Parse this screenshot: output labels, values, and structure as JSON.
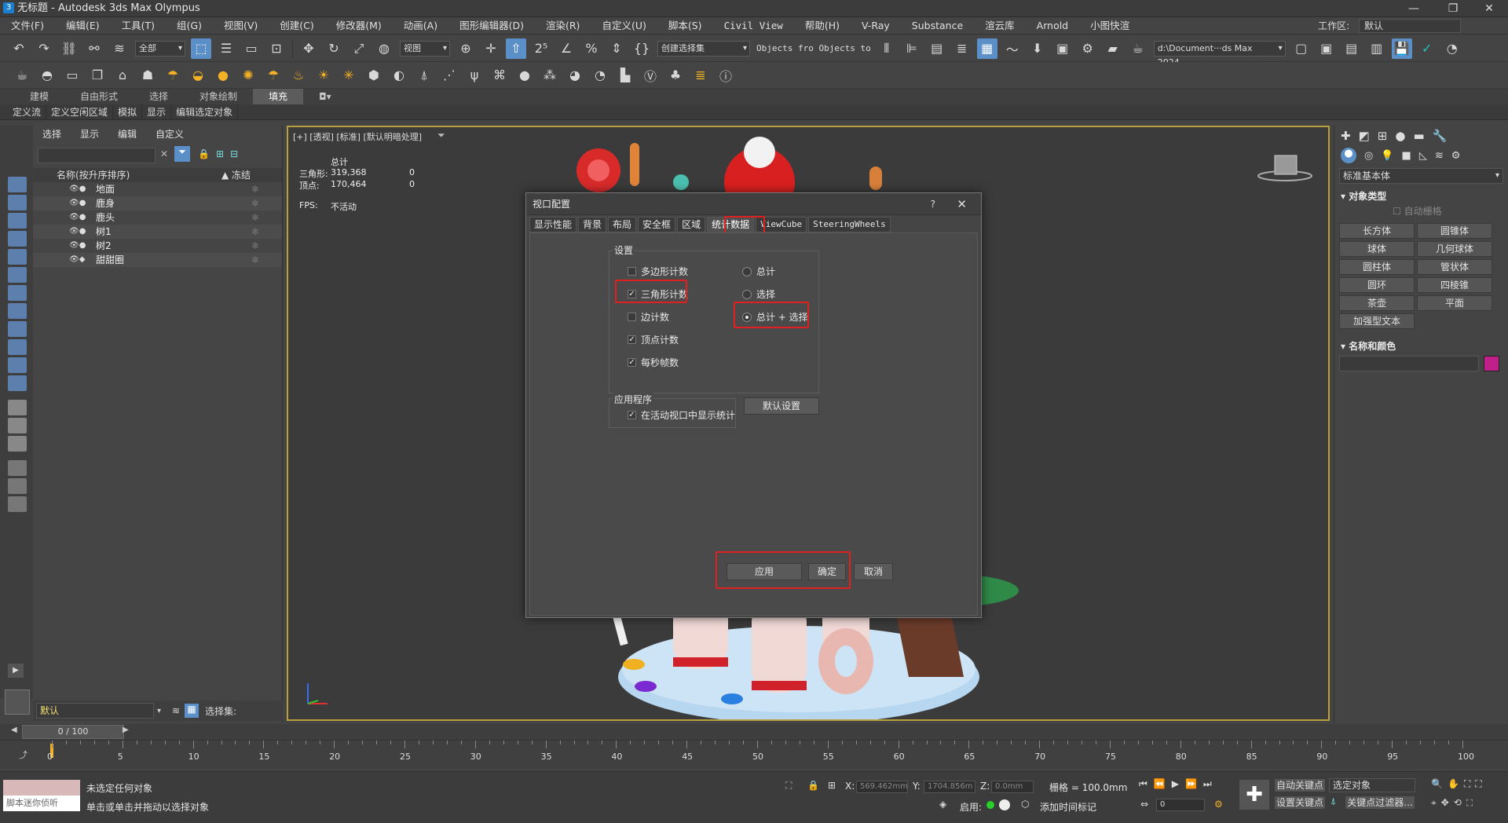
{
  "titlebar": {
    "title": "无标题 - Autodesk 3ds Max Olympus",
    "min": "—",
    "restore": "❐",
    "close": "✕"
  },
  "menu": [
    "文件(F)",
    "编辑(E)",
    "工具(T)",
    "组(G)",
    "视图(V)",
    "创建(C)",
    "修改器(M)",
    "动画(A)",
    "图形编辑器(D)",
    "渲染(R)",
    "自定义(U)",
    "脚本(S)",
    "Civil View",
    "帮助(H)",
    "V-Ray",
    "Substance",
    "渲云库",
    "Arnold",
    "小图快渲"
  ],
  "workspace": {
    "label": "工作区:",
    "value": "默认"
  },
  "toolbar1": {
    "filter_combo": "全部",
    "view_combo": "视图",
    "selset_combo": "创建选择集",
    "objects_text": "Objects fro Objects to",
    "path_combo": "d:\\Document···ds Max 2024"
  },
  "ribbon": {
    "tabs": [
      "建模",
      "自由形式",
      "选择",
      "对象绘制",
      "填充"
    ],
    "active": 4
  },
  "subribbon": [
    "定义流",
    "定义空闲区域",
    "模拟",
    "显示",
    "编辑选定对象"
  ],
  "scene": {
    "tabs": [
      "选择",
      "显示",
      "编辑",
      "自定义"
    ],
    "col_name": "名称(按升序排序)",
    "col_frozen": "▲ 冻结",
    "rows": [
      "地面",
      "鹿身",
      "鹿头",
      "树1",
      "树2",
      "甜甜圈"
    ],
    "layer_value": "默认",
    "selset_label": "选择集:"
  },
  "viewport": {
    "label": "[+] [透视] [标准] [默认明暗处理]",
    "stats_header": "总计",
    "tri_label": "三角形:",
    "tri_total": "319,368",
    "tri_sel": "0",
    "vert_label": "顶点:",
    "vert_total": "170,464",
    "vert_sel": "0",
    "fps_label": "FPS:",
    "fps_value": "不活动"
  },
  "cmdpanel": {
    "combo": "标准基本体",
    "objtype_header": "对象类型",
    "autogrid": "自动栅格",
    "buttons": [
      "长方体",
      "圆锥体",
      "球体",
      "几何球体",
      "圆柱体",
      "管状体",
      "圆环",
      "四棱锥",
      "茶壶",
      "平面",
      "加强型文本"
    ],
    "namecolor_header": "名称和颜色",
    "color": "#c0208a"
  },
  "dialog": {
    "title": "视口配置",
    "help": "?",
    "close": "✕",
    "tabs": [
      "显示性能",
      "背景",
      "布局",
      "安全框",
      "区域",
      "统计数据",
      "ViewCube",
      "SteeringWheels"
    ],
    "active_tab": 5,
    "settings_group": "设置",
    "cb_poly": "多边形计数",
    "cb_tri": "三角形计数",
    "cb_edge": "边计数",
    "cb_vert": "顶点计数",
    "cb_fps": "每秒帧数",
    "rb_total": "总计",
    "rb_sel": "选择",
    "rb_both": "总计 + 选择",
    "app_group": "应用程序",
    "cb_show": "在活动视口中显示统计",
    "btn_default": "默认设置",
    "btn_apply": "应用",
    "btn_ok": "确定",
    "btn_cancel": "取消"
  },
  "timeline": {
    "frame": "0 / 100",
    "ticks": [
      "0",
      "5",
      "10",
      "15",
      "20",
      "25",
      "30",
      "35",
      "40",
      "45",
      "50",
      "55",
      "60",
      "65",
      "70",
      "75",
      "80",
      "85",
      "90",
      "95",
      "100"
    ]
  },
  "status": {
    "script_label": "脚本迷你侦听",
    "msg1": "未选定任何对象",
    "msg2": "单击或单击并拖动以选择对象",
    "x_label": "X:",
    "x_value": "569.462mm",
    "y_label": "Y:",
    "y_value": "1704.856m",
    "z_label": "Z:",
    "z_value": "0.0mm",
    "grid": "栅格 = 100.0mm",
    "enable_label": "启用:",
    "add_time_tag": "添加时间标记",
    "auto_key": "自动关键点",
    "set_key": "设置关键点",
    "sel_obj": "选定对象",
    "key_filter": "关键点过滤器...",
    "frame_field": "0"
  }
}
